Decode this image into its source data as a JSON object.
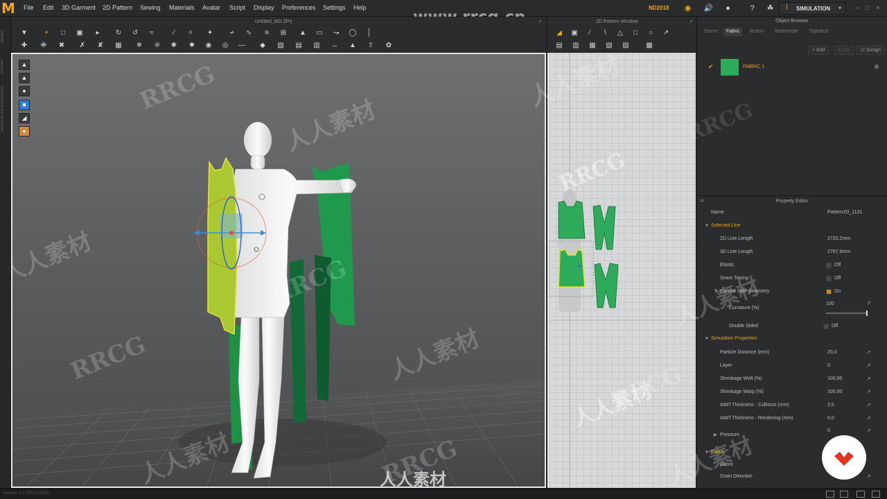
{
  "app": {
    "logo": "M",
    "badge": "ND2018",
    "mode_label": "SIMULATION",
    "version": "Version: 4.2.293 (r37526)"
  },
  "menu": [
    "File",
    "Edit",
    "3D Garment",
    "2D Pattern",
    "Sewing",
    "Materials",
    "Avatar",
    "Script",
    "Display",
    "Preferences",
    "Settings",
    "Help"
  ],
  "left_strip": [
    "LIBRARY",
    "HISTORY",
    "MODULAR CONFIGURATOR"
  ],
  "viewport3d": {
    "title": "Untitled_MD.ZPrj"
  },
  "viewport2d": {
    "title": "2D Pattern Window"
  },
  "object_browser": {
    "title": "Object Browser",
    "tabs": [
      "Scene",
      "Fabric",
      "Button",
      "Buttonhole",
      "Topstitch"
    ],
    "active_tab": "Fabric",
    "actions": [
      "+ Add",
      "Copy",
      "u\" Assign"
    ],
    "fabric_item": {
      "name": "FABRIC 1",
      "color": "#2eaa5b"
    }
  },
  "property_editor": {
    "title": "Property Editor",
    "name_label": "Name",
    "name_value": "Pattern2D_1131",
    "selected_line": "Selected Line",
    "line_2d_label": "2D Line Length",
    "line_2d_value": "2720.2mm",
    "line_3d_label": "3D Line Length",
    "line_3d_value": "2767.9mm",
    "elastic_label": "Elastic",
    "elastic_value": "Off",
    "seam_label": "Seam Taping",
    "seam_value": "Off",
    "curved_label": "Curved Side Geometry",
    "curved_value": "On",
    "curvature_label": "Curvature (%)",
    "curvature_value": "100",
    "double_label": "Double Sided",
    "double_value": "Off",
    "sim_props": "Simulation Properties",
    "particle_label": "Particle Distance (mm)",
    "particle_value": "20,0",
    "layer_label": "Layer",
    "layer_value": "0",
    "weft_label": "Shrinkage Weft (%)",
    "weft_value": "100,00",
    "warp_label": "Shrinkage Warp (%)",
    "warp_value": "100,00",
    "coll_label": "Add'l Thickness - Collision (mm)",
    "coll_value": "2,5",
    "rend_label": "Add'l Thickness - Rendering (mm)",
    "rend_value": "0,0",
    "pressure_label": "Pressure",
    "pressure_value": "0",
    "fabric_section": "Fabric",
    "fabric_label": "Fabric",
    "grain_label": "Grain Direction"
  },
  "watermarks": {
    "latin": "RRCG",
    "cjk": "人人素材",
    "site": "www.rrcg.cn"
  },
  "colors": {
    "accent": "#f0a800",
    "fabric_green": "#2eaa5b",
    "selection_yellow": "#e8e23a"
  }
}
